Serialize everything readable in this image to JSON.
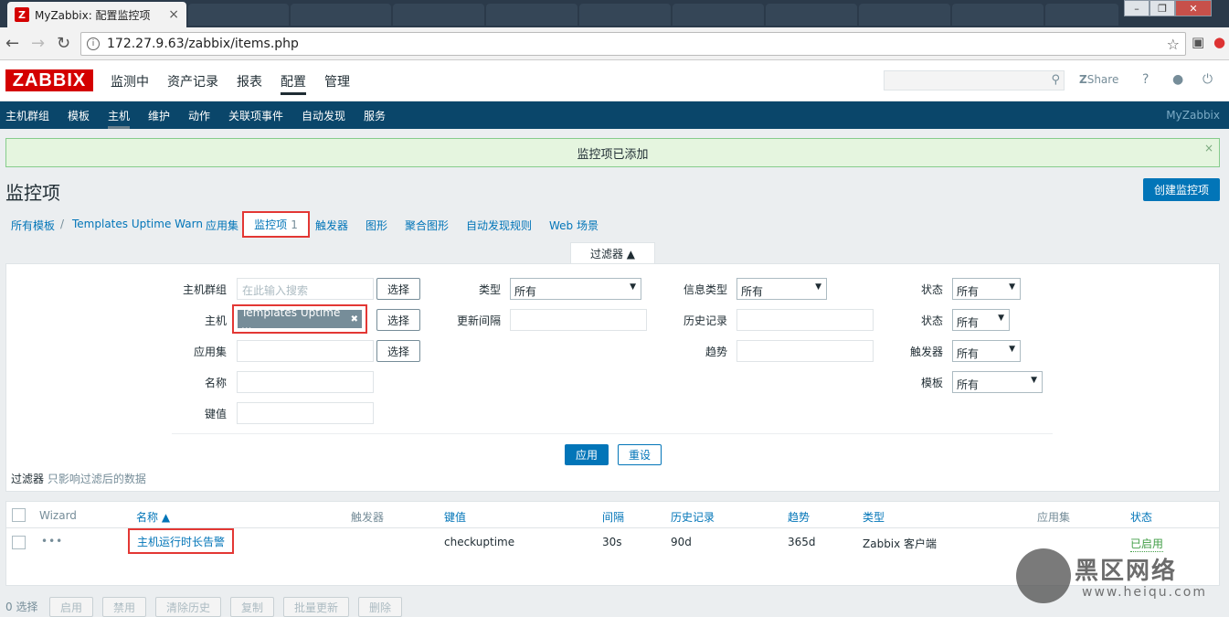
{
  "browser": {
    "tab_title": "MyZabbix: 配置监控项",
    "tab_favicon": "Z",
    "url": "172.27.9.63/zabbix/items.php"
  },
  "header": {
    "logo": "ZABBIX",
    "menu": [
      "监测中",
      "资产记录",
      "报表",
      "配置",
      "管理"
    ],
    "share": "Share",
    "help": "?",
    "search_placeholder": ""
  },
  "subnav": {
    "items": [
      "主机群组",
      "模板",
      "主机",
      "维护",
      "动作",
      "关联项事件",
      "自动发现",
      "服务"
    ],
    "right": "MyZabbix"
  },
  "message": {
    "text": "监控项已添加",
    "close": "×"
  },
  "page": {
    "title": "监控项",
    "create_button": "创建监控项"
  },
  "breadcrumbs": {
    "all_templates": "所有模板",
    "separator": "/",
    "template": "Templates Uptime Warn",
    "apps": "应用集",
    "items": "监控项",
    "items_count": "1",
    "triggers": "触发器",
    "graphs": "图形",
    "screens": "聚合图形",
    "discovery": "自动发现规则",
    "web": "Web 场景"
  },
  "filter": {
    "tab_label": "过滤器 ▲",
    "hostgroup_label": "主机群组",
    "hostgroup_placeholder": "在此输入搜索",
    "select": "选择",
    "host_label": "主机",
    "host_tag": "Templates Uptime ...",
    "host_tag_remove": "✖",
    "app_label": "应用集",
    "name_label": "名称",
    "key_label": "键值",
    "type_label": "类型",
    "type_value": "所有",
    "interval_label": "更新间隔",
    "info_type_label": "信息类型",
    "info_type_value": "所有",
    "history_label": "历史记录",
    "trend_label": "趋势",
    "state_label": "状态",
    "state_value": "所有",
    "status_label": "状态",
    "status_value": "所有",
    "triggers_label": "触发器",
    "triggers_value": "所有",
    "template_label": "模板",
    "template_value": "所有",
    "apply": "应用",
    "reset": "重设",
    "note_prefix": "过滤器",
    "note_text": "只影响过滤后的数据"
  },
  "table": {
    "headers": {
      "wizard": "Wizard",
      "name": "名称 ▲",
      "triggers": "触发器",
      "key": "键值",
      "interval": "间隔",
      "history": "历史记录",
      "trends": "趋势",
      "type": "类型",
      "applications": "应用集",
      "status": "状态"
    },
    "rows": [
      {
        "wizard": "•••",
        "name": "主机运行时长告警",
        "triggers": "",
        "key": "checkuptime",
        "interval": "30s",
        "history": "90d",
        "trends": "365d",
        "type": "Zabbix 客户端",
        "applications": "",
        "status": "已启用"
      }
    ]
  },
  "bottom": {
    "selected": "0 选择",
    "buttons": [
      "启用",
      "禁用",
      "清除历史",
      "复制",
      "批量更新",
      "删除"
    ]
  },
  "watermark": {
    "text": "黑区网络",
    "url": "www.heiqu.com"
  }
}
